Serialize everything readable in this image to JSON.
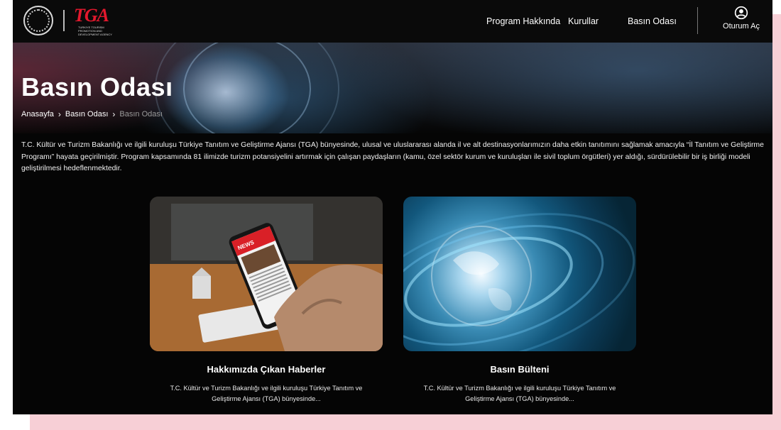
{
  "header": {
    "logo_text": "TGA",
    "logo_subtitle": "TURKIYE TOURISM PROMOTION AND DEVELOPMENT AGENCY",
    "nav": [
      {
        "label": "Program Hakkında"
      },
      {
        "label": "Kurullar"
      },
      {
        "label": "Basın Odası"
      }
    ],
    "login_label": "Oturum Aç",
    "login_icon": "user-circle-icon"
  },
  "hero": {
    "title": "Basın Odası",
    "breadcrumb": [
      "Anasayfa",
      "Basın Odası",
      "Basın Odası"
    ]
  },
  "intro": {
    "text": "T.C. Kültür ve Turizm Bakanlığı ve ilgili kuruluşu Türkiye Tanıtım ve Geliştirme Ajansı (TGA) bünyesinde, ulusal ve uluslararası alanda il ve alt destinasyonlarımızın daha etkin tanıtımını sağlamak amacıyla “İl Tanıtım ve Geliştirme Programı” hayata geçirilmiştir. Program kapsamında 81 ilimizde turizm potansiyelini artırmak için çalışan paydaşların (kamu, özel sektör kurum ve kuruluşları ile sivil toplum örgütleri) yer aldığı, sürdürülebilir bir iş birliği modeli geliştirilmesi hedeflenmektedir."
  },
  "cards": [
    {
      "title": "Hakkımızda Çıkan Haberler",
      "description": "T.C. Kültür ve Turizm Bakanlığı ve ilgili kuruluşu Türkiye Tanıtım ve Geliştirme Ajansı (TGA) bünyesinde...",
      "phone_label": "NEWS"
    },
    {
      "title": "Basın Bülteni",
      "description": "T.C. Kültür ve Turizm Bakanlığı ve ilgili kuruluşu Türkiye Tanıtım ve Geliştirme Ajansı (TGA) bünyesinde..."
    }
  ],
  "colors": {
    "brand_red": "#e3182d",
    "page_bg": "#050505",
    "outer_pink": "#f7cfd6"
  }
}
